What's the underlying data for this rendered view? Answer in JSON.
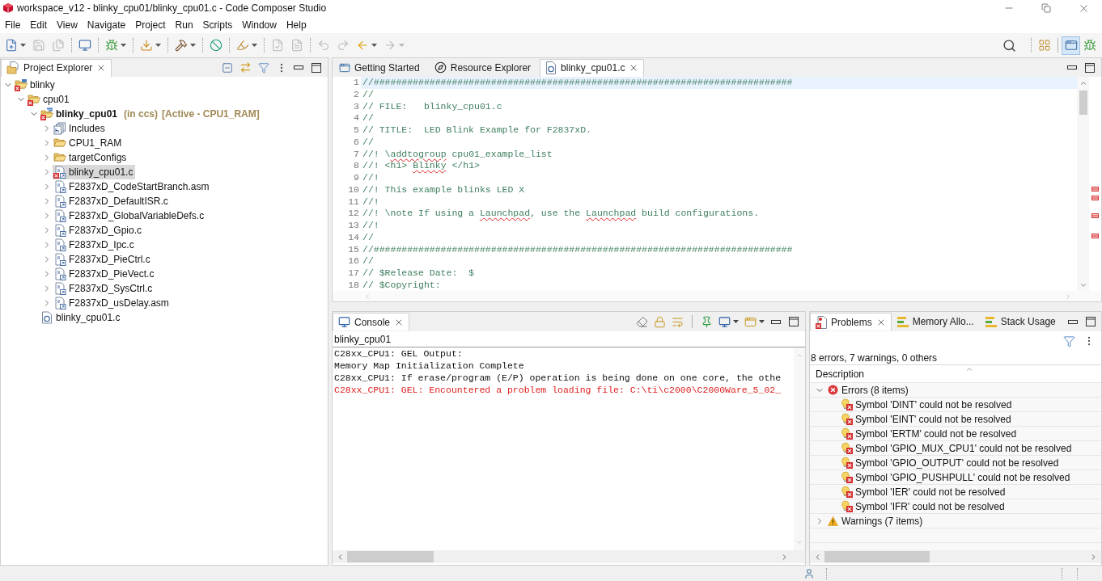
{
  "window": {
    "title": "workspace_v12 - blinky_cpu01/blinky_cpu01.c - Code Composer Studio"
  },
  "menu_bar": [
    "File",
    "Edit",
    "View",
    "Navigate",
    "Project",
    "Run",
    "Scripts",
    "Window",
    "Help"
  ],
  "toolbar": {
    "groups": [
      [
        {
          "kind": "new",
          "dropdown": true,
          "disabled": false
        },
        {
          "kind": "save",
          "dropdown": false,
          "disabled": true
        },
        {
          "kind": "save-all",
          "dropdown": false,
          "disabled": true
        }
      ],
      [
        {
          "kind": "terminal",
          "dropdown": false,
          "disabled": false
        }
      ],
      [
        {
          "kind": "debug",
          "dropdown": true,
          "disabled": false
        }
      ],
      [
        {
          "kind": "flash",
          "dropdown": true,
          "disabled": false
        }
      ],
      [
        {
          "kind": "build",
          "dropdown": true,
          "disabled": false
        }
      ],
      [
        {
          "kind": "search",
          "dropdown": false,
          "disabled": false
        }
      ],
      [
        {
          "kind": "marker",
          "dropdown": true,
          "disabled": false
        }
      ],
      [
        {
          "kind": "next-annotation",
          "dropdown": false,
          "disabled": true
        },
        {
          "kind": "previous-annotation",
          "dropdown": false,
          "disabled": true
        }
      ],
      [
        {
          "kind": "last-edit-back",
          "dropdown": false,
          "disabled": true
        },
        {
          "kind": "last-edit-forward",
          "dropdown": false,
          "disabled": true
        },
        {
          "kind": "back",
          "dropdown": true,
          "disabled": false
        },
        {
          "kind": "forward",
          "dropdown": true,
          "disabled": true
        }
      ]
    ],
    "perspectives": [
      {
        "kind": "edit",
        "selected": true
      },
      {
        "kind": "debug",
        "selected": false
      }
    ]
  },
  "project_explorer": {
    "tabs": [
      {
        "label": "Project Explorer",
        "kind": "project-explorer",
        "selected": true
      }
    ],
    "tree": [
      {
        "label": "blinky",
        "kind": "project",
        "expanded": true,
        "selected": false,
        "active": false,
        "error": true,
        "children": [
          {
            "label": "cpu01",
            "kind": "folder",
            "expanded": true,
            "selected": false,
            "active": false,
            "error": true,
            "children": [
              {
                "label": "blinky_cpu01",
                "decorations": [
                  "(in ccs)",
                  "[Active - CPU1_RAM]"
                ],
                "kind": "ccs-project",
                "expanded": true,
                "selected": false,
                "active": true,
                "error": true,
                "children": [
                  {
                    "label": "Includes",
                    "kind": "includes",
                    "expanded": false,
                    "selected": false,
                    "active": false,
                    "error": false
                  },
                  {
                    "label": "CPU1_RAM",
                    "kind": "folder",
                    "expanded": false,
                    "selected": false,
                    "active": false,
                    "error": false
                  },
                  {
                    "label": "targetConfigs",
                    "kind": "folder",
                    "expanded": false,
                    "selected": false,
                    "active": false,
                    "error": false
                  },
                  {
                    "label": "blinky_cpu01.c",
                    "kind": "linked-file",
                    "expanded": false,
                    "selected": true,
                    "active": false,
                    "error": true
                  },
                  {
                    "label": "F2837xD_CodeStartBranch.asm",
                    "kind": "linked-file",
                    "expanded": false,
                    "selected": false,
                    "active": false,
                    "error": false
                  },
                  {
                    "label": "F2837xD_DefaultISR.c",
                    "kind": "linked-file",
                    "expanded": false,
                    "selected": false,
                    "active": false,
                    "error": false
                  },
                  {
                    "label": "F2837xD_GlobalVariableDefs.c",
                    "kind": "linked-file",
                    "expanded": false,
                    "selected": false,
                    "active": false,
                    "error": false
                  },
                  {
                    "label": "F2837xD_Gpio.c",
                    "kind": "linked-file",
                    "expanded": false,
                    "selected": false,
                    "active": false,
                    "error": false
                  },
                  {
                    "label": "F2837xD_Ipc.c",
                    "kind": "linked-file",
                    "expanded": false,
                    "selected": false,
                    "active": false,
                    "error": false
                  },
                  {
                    "label": "F2837xD_PieCtrl.c",
                    "kind": "linked-file",
                    "expanded": false,
                    "selected": false,
                    "active": false,
                    "error": false
                  },
                  {
                    "label": "F2837xD_PieVect.c",
                    "kind": "linked-file",
                    "expanded": false,
                    "selected": false,
                    "active": false,
                    "error": false
                  },
                  {
                    "label": "F2837xD_SysCtrl.c",
                    "kind": "linked-file",
                    "expanded": false,
                    "selected": false,
                    "active": false,
                    "error": false
                  },
                  {
                    "label": "F2837xD_usDelay.asm",
                    "kind": "linked-file",
                    "expanded": false,
                    "selected": false,
                    "active": false,
                    "error": false
                  }
                ]
              },
              {
                "label": "blinky_cpu01.c",
                "kind": "c-file",
                "selected": false,
                "active": false,
                "error": false
              }
            ]
          }
        ]
      }
    ]
  },
  "editor": {
    "tabs": [
      {
        "label": "Getting Started",
        "kind": "welcome",
        "selected": false
      },
      {
        "label": "Resource Explorer",
        "kind": "explorer",
        "selected": false
      },
      {
        "label": "blinky_cpu01.c",
        "kind": "c-file",
        "selected": true
      }
    ],
    "lines": [
      {
        "number": "1",
        "current": true,
        "segments": [
          {
            "text": "//###########################################################################",
            "misspelled": false
          }
        ]
      },
      {
        "number": "2",
        "current": false,
        "segments": [
          {
            "text": "//",
            "misspelled": false
          }
        ]
      },
      {
        "number": "3",
        "current": false,
        "segments": [
          {
            "text": "// FILE:   blinky_cpu01.c",
            "misspelled": false
          }
        ]
      },
      {
        "number": "4",
        "current": false,
        "segments": [
          {
            "text": "//",
            "misspelled": false
          }
        ]
      },
      {
        "number": "5",
        "current": false,
        "segments": [
          {
            "text": "// TITLE:  LED Blink Example for F2837xD.",
            "misspelled": false
          }
        ]
      },
      {
        "number": "6",
        "current": false,
        "segments": [
          {
            "text": "//",
            "misspelled": false
          }
        ]
      },
      {
        "number": "7",
        "current": false,
        "segments": [
          {
            "text": "//! \\",
            "misspelled": false
          },
          {
            "text": "addtogroup",
            "misspelled": true
          },
          {
            "text": " cpu01_example_list",
            "misspelled": false
          }
        ]
      },
      {
        "number": "8",
        "current": false,
        "segments": [
          {
            "text": "//! <h1> ",
            "misspelled": false
          },
          {
            "text": "Blinky",
            "misspelled": true
          },
          {
            "text": " </h1>",
            "misspelled": false
          }
        ]
      },
      {
        "number": "9",
        "current": false,
        "segments": [
          {
            "text": "//!",
            "misspelled": false
          }
        ]
      },
      {
        "number": "10",
        "current": false,
        "segments": [
          {
            "text": "//! This example blinks LED X",
            "misspelled": false
          }
        ]
      },
      {
        "number": "11",
        "current": false,
        "segments": [
          {
            "text": "//!",
            "misspelled": false
          }
        ]
      },
      {
        "number": "12",
        "current": false,
        "segments": [
          {
            "text": "//! \\note If using a ",
            "misspelled": false
          },
          {
            "text": "Launchpad",
            "misspelled": true
          },
          {
            "text": ", use the ",
            "misspelled": false
          },
          {
            "text": "Launchpad",
            "misspelled": true
          },
          {
            "text": " build configurations.",
            "misspelled": false
          }
        ]
      },
      {
        "number": "13",
        "current": false,
        "segments": [
          {
            "text": "//!",
            "misspelled": false
          }
        ]
      },
      {
        "number": "14",
        "current": false,
        "segments": [
          {
            "text": "//",
            "misspelled": false
          }
        ]
      },
      {
        "number": "15",
        "current": false,
        "segments": [
          {
            "text": "//###########################################################################",
            "misspelled": false
          }
        ]
      },
      {
        "number": "16",
        "current": false,
        "segments": [
          {
            "text": "//",
            "misspelled": false
          }
        ]
      },
      {
        "number": "17",
        "current": false,
        "segments": [
          {
            "text": "// $Release Date:  $",
            "misspelled": false
          }
        ]
      },
      {
        "number": "18",
        "current": false,
        "segments": [
          {
            "text": "// $Copyright:",
            "misspelled": false
          }
        ]
      }
    ]
  },
  "console": {
    "tabs": [
      {
        "label": "Console",
        "kind": "console",
        "selected": true
      }
    ],
    "name": "blinky_cpu01",
    "lines": [
      {
        "text": "C28xx_CPU1: GEL Output:",
        "kind": "info"
      },
      {
        "text": "Memory Map Initialization Complete",
        "kind": "info"
      },
      {
        "text": "C28xx_CPU1: If erase/program (E/P) operation is being done on one core, the othe",
        "kind": "info"
      },
      {
        "text": "C28xx_CPU1: GEL: Encountered a problem loading file: C:\\ti\\c2000\\C2000Ware_5_02_",
        "kind": "error"
      }
    ]
  },
  "problems": {
    "tabs": [
      {
        "label": "Problems",
        "kind": "problems",
        "selected": true
      },
      {
        "label": "Memory Allo...",
        "kind": "memory",
        "selected": false
      },
      {
        "label": "Stack Usage",
        "kind": "stack",
        "selected": false
      }
    ],
    "summary": "8 errors, 7 warnings, 0 others",
    "columns": [
      "Description"
    ],
    "groups": [
      {
        "label": "Errors (8 items)",
        "kind": "error",
        "expanded": true,
        "items": [
          "Symbol 'DINT' could not be resolved",
          "Symbol 'EINT' could not be resolved",
          "Symbol 'ERTM' could not be resolved",
          "Symbol 'GPIO_MUX_CPU1' could not be resolved",
          "Symbol 'GPIO_OUTPUT' could not be resolved",
          "Symbol 'GPIO_PUSHPULL' could not be resolved",
          "Symbol 'IER' could not be resolved",
          "Symbol 'IFR' could not be resolved"
        ]
      },
      {
        "label": "Warnings (7 items)",
        "kind": "warning",
        "expanded": false
      }
    ]
  }
}
